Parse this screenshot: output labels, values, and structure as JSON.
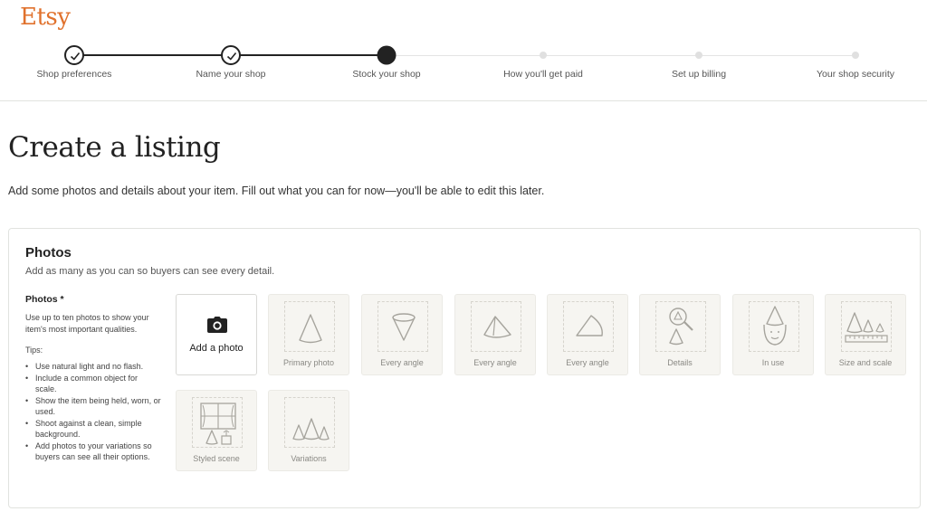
{
  "brand": {
    "logo": "Etsy",
    "color": "#e0712c"
  },
  "steps": [
    {
      "label": "Shop preferences",
      "state": "done"
    },
    {
      "label": "Name your shop",
      "state": "done"
    },
    {
      "label": "Stock your shop",
      "state": "active"
    },
    {
      "label": "How you'll get paid",
      "state": "todo"
    },
    {
      "label": "Set up billing",
      "state": "todo"
    },
    {
      "label": "Your shop security",
      "state": "todo"
    }
  ],
  "page": {
    "title": "Create a listing",
    "subtitle": "Add some photos and details about your item. Fill out what you can for now—you'll be able to edit this later."
  },
  "photos": {
    "title": "Photos",
    "subtitle": "Add as many as you can so buyers can see every detail.",
    "side_title": "Photos *",
    "side_desc": "Use up to ten photos to show your item's most important qualities.",
    "tips_label": "Tips:",
    "tips": [
      "Use natural light and no flash.",
      "Include a common object for scale.",
      "Show the item being held, worn, or used.",
      "Shoot against a clean, simple background.",
      "Add photos to your variations so buyers can see all their options."
    ],
    "add_label": "Add a photo",
    "add_icon": "camera-icon",
    "tiles": [
      {
        "label": "Primary photo",
        "icon": "cone-icon"
      },
      {
        "label": "Every angle",
        "icon": "cone-inverted-icon"
      },
      {
        "label": "Every angle",
        "icon": "cone-tilted-icon"
      },
      {
        "label": "Every angle",
        "icon": "cone-side-icon"
      },
      {
        "label": "Details",
        "icon": "magnifier-icon"
      },
      {
        "label": "In use",
        "icon": "cone-hat-face-icon"
      },
      {
        "label": "Size and scale",
        "icon": "ruler-cones-icon"
      },
      {
        "label": "Styled scene",
        "icon": "window-scene-icon"
      },
      {
        "label": "Variations",
        "icon": "cone-variations-icon"
      }
    ]
  }
}
